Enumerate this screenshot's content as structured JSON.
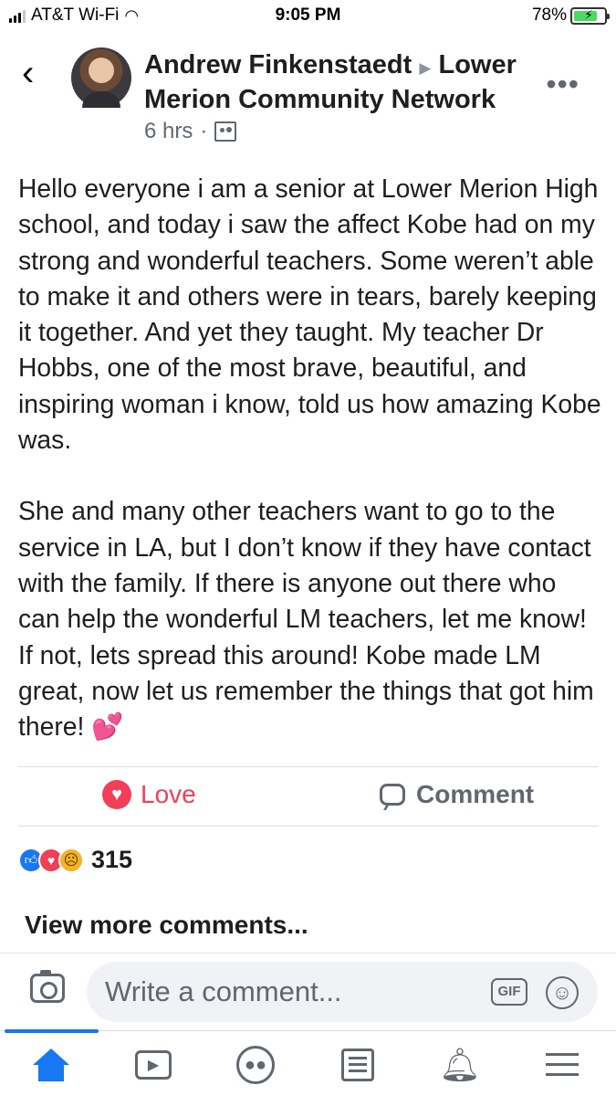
{
  "status_bar": {
    "carrier": "AT&T Wi-Fi",
    "time": "9:05 PM",
    "battery": "78%",
    "battery_level": 0.78
  },
  "post": {
    "author": "Andrew Finkenstaedt",
    "group": "Lower Merion Community Network",
    "time_ago": "6 hrs",
    "body_paragraphs": [
      "Hello everyone i am a senior at Lower Merion High school, and today i saw the affect Kobe had on my strong and wonderful teachers. Some weren’t able to make it and others were in tears, barely keeping it together. And yet they taught. My teacher Dr Hobbs, one of the most brave, beautiful, and inspiring woman i know, told us how amazing Kobe was.",
      "She and many other teachers want to go to the service in LA, but I don’t know if they have contact with the family. If there is anyone out there who can help the wonderful LM teachers, let me know! If not, lets spread this around! Kobe made LM great, now let us remember the things that got him there! 💕"
    ]
  },
  "actions": {
    "love_label": "Love",
    "comment_label": "Comment"
  },
  "reactions": {
    "count": "315",
    "icons": [
      "like-icon",
      "love-icon",
      "sad-icon"
    ]
  },
  "comments": {
    "view_more": "View more comments...",
    "placeholder": "Write a comment...",
    "gif_label": "GIF"
  },
  "tab_bar": {
    "items": [
      "home-icon",
      "video-icon",
      "groups-icon",
      "news-icon",
      "bell-icon",
      "menu-icon"
    ],
    "active": "home"
  },
  "colors": {
    "accent": "#1877f2",
    "love": "#f33e58",
    "secondary_text": "#606770"
  }
}
